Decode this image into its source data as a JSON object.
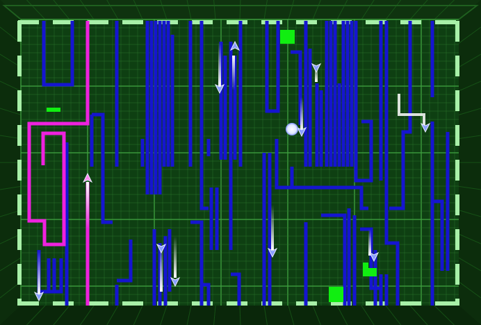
{
  "game": {
    "colors": {
      "wall_outer": "#0b2a0b",
      "wall_bevel": "#1d6a1d",
      "floor": "#0e3f12",
      "grid_line": "#2f7a2f",
      "grid_major": "#3fa03f",
      "border_dash": "#a8f0a8",
      "cpu_trail": "#1515d0",
      "player_trail": "#ee22dd",
      "bonus": "#11ee11",
      "orb": "#ffffff"
    },
    "trails": {
      "player": {
        "color_name": "magenta",
        "segment_count": 1,
        "direction": "up"
      },
      "cpu": {
        "color_name": "blue",
        "segment_count": 36
      }
    },
    "bikes": [
      {
        "owner": "player",
        "heading": "up",
        "icon": "player-bike-icon"
      },
      {
        "owner": "cpu",
        "heading": "down",
        "icon": "cpu-bike-icon"
      },
      {
        "owner": "cpu",
        "heading": "down",
        "icon": "cpu-bike-icon"
      },
      {
        "owner": "cpu",
        "heading": "up",
        "icon": "cpu-bike-icon"
      },
      {
        "owner": "cpu",
        "heading": "down",
        "icon": "cpu-bike-icon"
      },
      {
        "owner": "cpu",
        "heading": "down",
        "icon": "cpu-bike-icon"
      },
      {
        "owner": "cpu",
        "heading": "down",
        "icon": "cpu-bike-icon"
      },
      {
        "owner": "cpu",
        "heading": "down",
        "icon": "cpu-bike-icon"
      },
      {
        "owner": "cpu",
        "heading": "down",
        "icon": "cpu-bike-icon"
      },
      {
        "owner": "cpu",
        "heading": "down",
        "icon": "cpu-bike-icon"
      },
      {
        "owner": "cpu",
        "heading": "down",
        "icon": "cpu-bike-icon"
      }
    ],
    "items": {
      "bonus_blocks": 3,
      "energy_orb": 1
    }
  }
}
